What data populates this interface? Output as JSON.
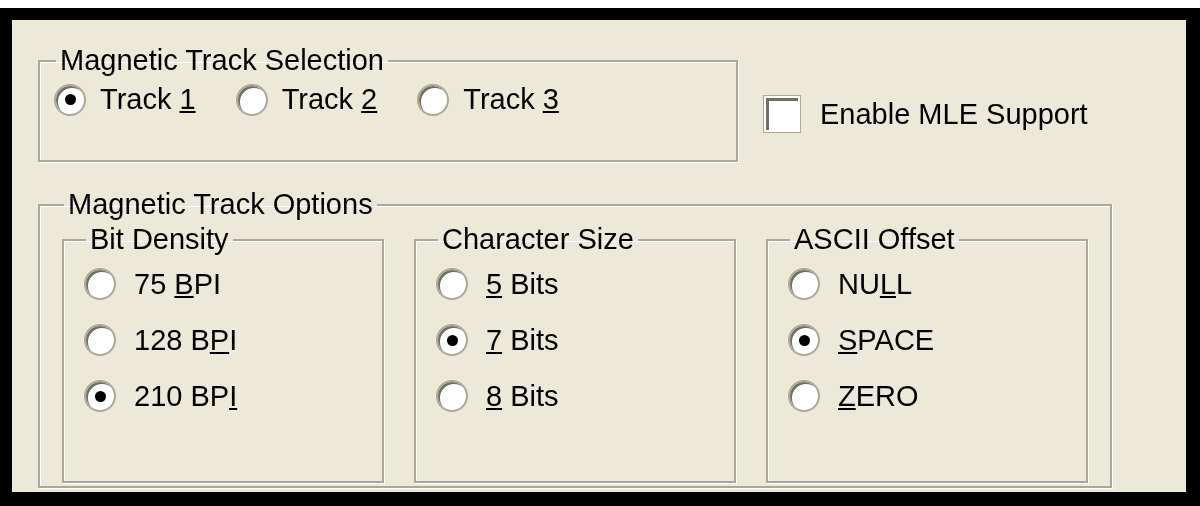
{
  "track_selection": {
    "title": "Magnetic Track Selection",
    "options": [
      {
        "before": "Track ",
        "key": "1",
        "selected": true
      },
      {
        "before": "Track ",
        "key": "2",
        "selected": false
      },
      {
        "before": "Track ",
        "key": "3",
        "selected": false
      }
    ]
  },
  "mle_support": {
    "label": "Enable MLE Support",
    "checked": false
  },
  "track_options": {
    "title": "Magnetic Track Options",
    "groups": [
      {
        "title": "Bit Density",
        "options": [
          {
            "before": "75 ",
            "key": "B",
            "after": "PI",
            "selected": false
          },
          {
            "before": "128 B",
            "key": "P",
            "after": "I",
            "selected": false
          },
          {
            "before": "210 BP",
            "key": "I",
            "selected": true
          }
        ]
      },
      {
        "title": "Character Size",
        "options": [
          {
            "key": "5",
            "after": " Bits",
            "selected": false
          },
          {
            "key": "7",
            "after": " Bits",
            "selected": true
          },
          {
            "key": "8",
            "after": " Bits",
            "selected": false
          }
        ]
      },
      {
        "title": "ASCII Offset",
        "options": [
          {
            "before": "NU",
            "key": "L",
            "after": "L",
            "selected": false
          },
          {
            "key": "S",
            "after": "PACE",
            "selected": true
          },
          {
            "key": "Z",
            "after": "ERO",
            "selected": false
          }
        ]
      }
    ]
  }
}
